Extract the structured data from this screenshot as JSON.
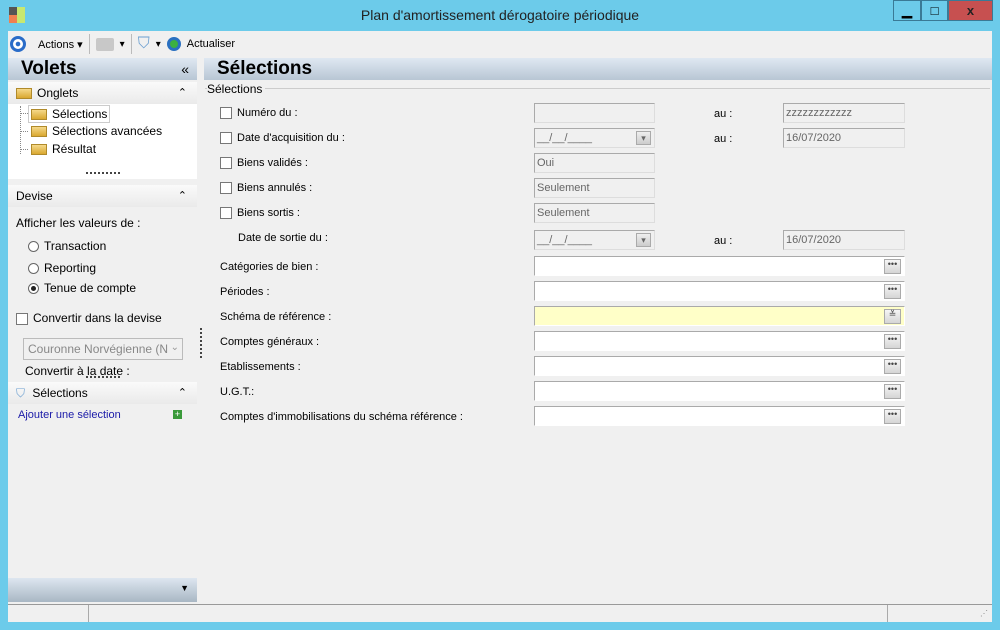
{
  "window": {
    "title": "Plan d'amortissement dérogatoire périodique",
    "minimize": "▁",
    "maximize": "□",
    "close": "x"
  },
  "toolbar": {
    "actions": "Actions",
    "refresh": "Actualiser"
  },
  "left": {
    "title": "Volets",
    "collapse": "«",
    "onglets": {
      "title": "Onglets",
      "items": [
        "Sélections",
        "Sélections avancées",
        "Résultat"
      ]
    },
    "devise": {
      "title": "Devise",
      "show_label": "Afficher les valeurs de :",
      "options": [
        "Transaction",
        "Reporting",
        "Tenue de compte"
      ],
      "selected": "Tenue de compte",
      "convert_label": "Convertir dans la devise",
      "currency": "Couronne Norvégienne (N",
      "convert_date": "Convertir à la date :"
    },
    "selections": {
      "title": "Sélections",
      "add": "Ajouter une sélection"
    }
  },
  "main": {
    "title": "Sélections",
    "group": "Sélections",
    "au": "au :",
    "rows": {
      "numero": {
        "label": "Numéro du :",
        "from": "",
        "to": "zzzzzzzzzzzz"
      },
      "date_acq": {
        "label": "Date d'acquisition du :",
        "from": "__/__/____",
        "to": "16/07/2020"
      },
      "valides": {
        "label": "Biens validés :",
        "value": "Oui"
      },
      "annules": {
        "label": "Biens annulés :",
        "value": "Seulement"
      },
      "sortis": {
        "label": "Biens sortis :",
        "value": "Seulement"
      },
      "date_sortie": {
        "label": "Date de sortie du :",
        "from": "__/__/____",
        "to": "16/07/2020"
      }
    },
    "fields": [
      "Catégories de bien :",
      "Périodes :",
      "Schéma de référence :",
      "Comptes généraux :",
      "Etablissements :",
      "U.G.T.:",
      "Comptes d'immobilisations du schéma référence :"
    ]
  }
}
